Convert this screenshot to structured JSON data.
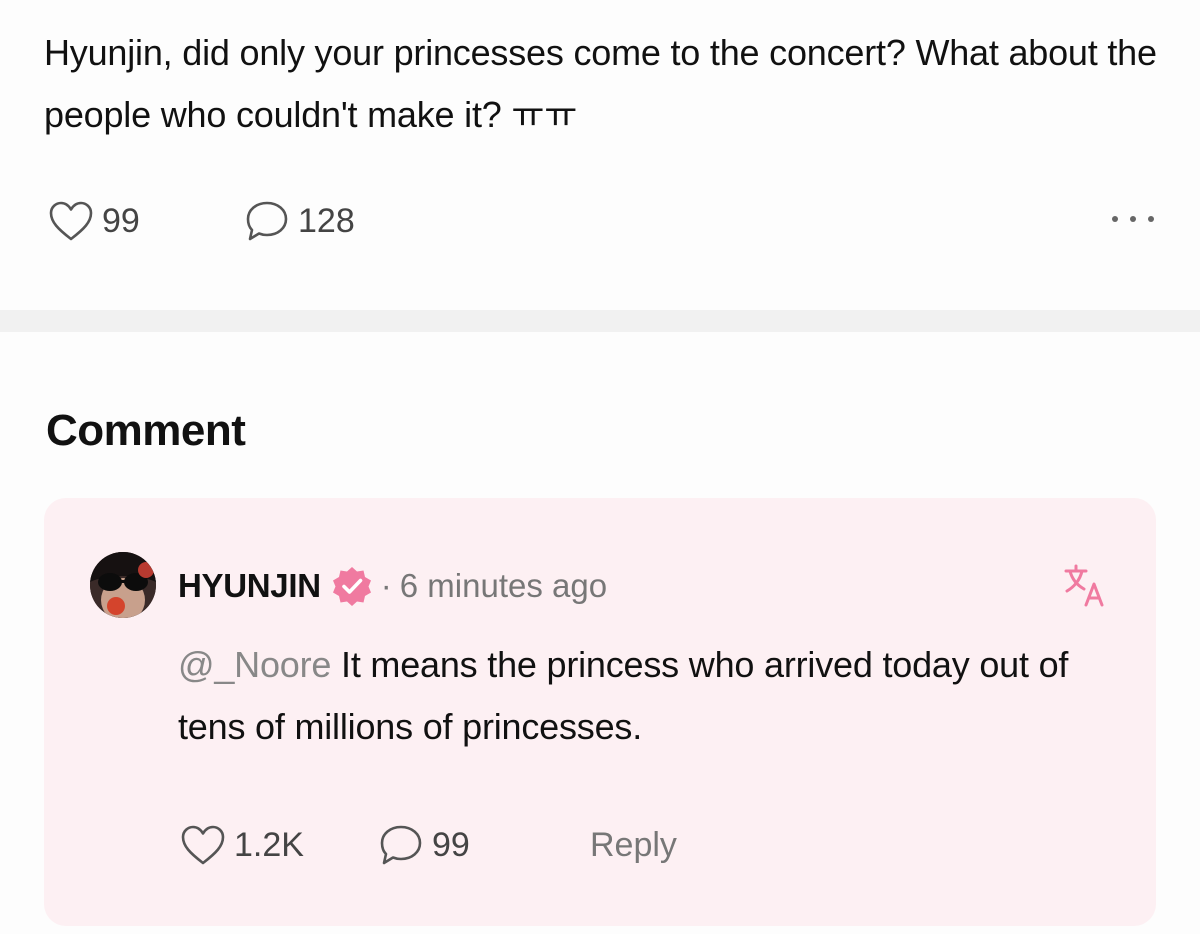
{
  "post": {
    "text": "Hyunjin, did only your princesses come to the concert? What about the people who couldn't make it? ㅠㅠ",
    "likes": "99",
    "comments": "128"
  },
  "comment_section": {
    "title": "Comment",
    "comment": {
      "username": "HYUNJIN",
      "separator": "·",
      "time": "6 minutes ago",
      "mention": "@_Noore",
      "text": " It means the princess who arrived today out of tens of millions of princesses.",
      "likes": "1.2K",
      "replies": "99",
      "reply_label": "Reply"
    }
  },
  "icons": {
    "like": "heart-outline-icon",
    "comment": "speech-bubble-icon",
    "more": "more-dots-icon",
    "verified": "verified-badge-icon",
    "translate": "translate-icon"
  },
  "colors": {
    "accent_pink": "#f07aa0",
    "card_background": "#fdf0f3",
    "muted_text": "#777777"
  }
}
